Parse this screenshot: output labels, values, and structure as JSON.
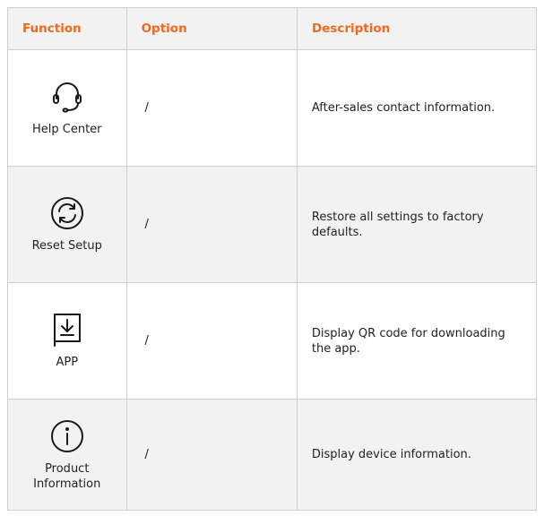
{
  "header": {
    "function_label": "Function",
    "option_label": "Option",
    "description_label": "Description"
  },
  "rows": [
    {
      "icon": "headset-icon",
      "function": "Help Center",
      "option": "/",
      "description": "After-sales contact information."
    },
    {
      "icon": "reset-icon",
      "function": "Reset Setup",
      "option": "/",
      "description": "Restore all settings to factory defaults."
    },
    {
      "icon": "download-icon",
      "function": "APP",
      "option": "/",
      "description": "Display QR code for downloading the app."
    },
    {
      "icon": "info-icon",
      "function": "Product Information",
      "option": "/",
      "description": "Display device information."
    }
  ],
  "colors": {
    "header_text": "#ef6a1f",
    "alt_row_background": "#f2f2f2",
    "border": "#cfcfcf"
  }
}
